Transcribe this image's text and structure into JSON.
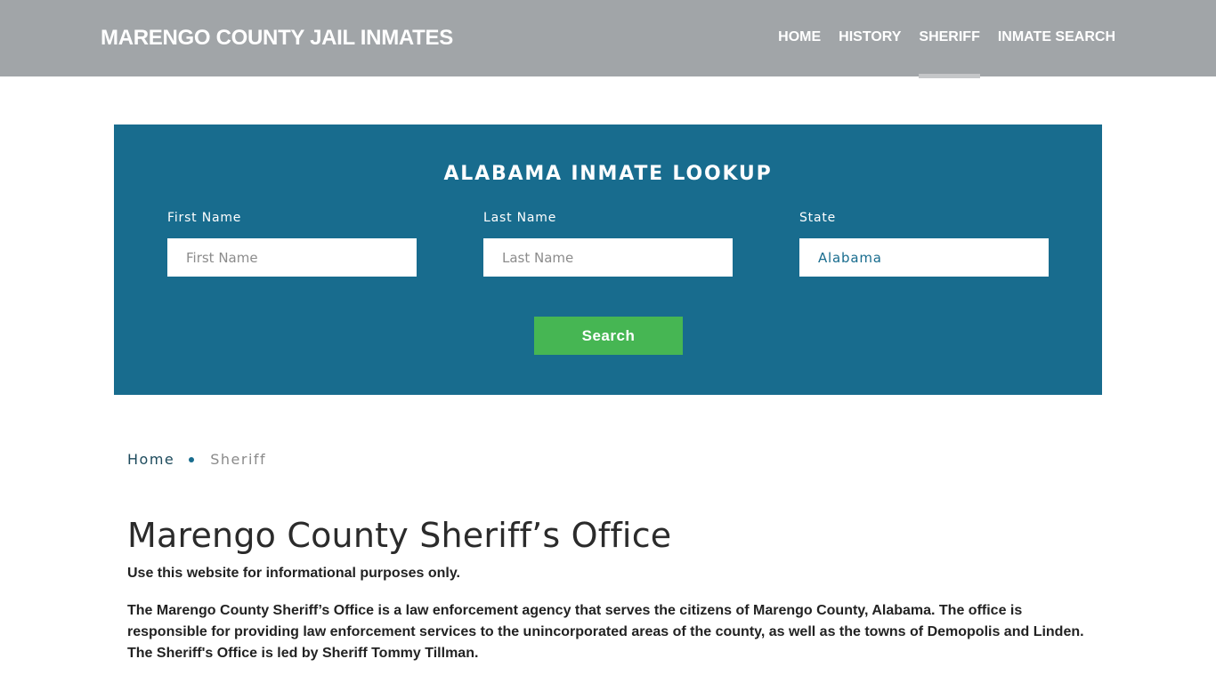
{
  "header": {
    "brand": "MARENGO COUNTY JAIL INMATES",
    "nav": [
      {
        "label": "HOME"
      },
      {
        "label": "HISTORY"
      },
      {
        "label": "SHERIFF"
      },
      {
        "label": "INMATE SEARCH"
      }
    ]
  },
  "lookup": {
    "title": "ALABAMA INMATE LOOKUP",
    "first_name": {
      "label": "First Name",
      "placeholder": "First Name"
    },
    "last_name": {
      "label": "Last Name",
      "placeholder": "Last Name"
    },
    "state": {
      "label": "State",
      "value": "Alabama"
    },
    "search_label": "Search"
  },
  "breadcrumb": {
    "home": "Home",
    "current": "Sheriff"
  },
  "main": {
    "title": "Marengo County Sheriff’s Office",
    "disclaimer": "Use this website for informational purposes only.",
    "paragraph": "The Marengo County Sheriff’s Office is a law enforcement agency that serves the citizens of Marengo County, Alabama. The office is responsible for providing law enforcement services to the unincorporated areas of the county, as well as the towns of Demopolis and Linden. The Sheriff's Office is led by Sheriff Tommy Tillman."
  },
  "colors": {
    "header_bg": "#a1a5a8",
    "lookup_bg": "#186c8e",
    "search_button": "#46b653"
  }
}
